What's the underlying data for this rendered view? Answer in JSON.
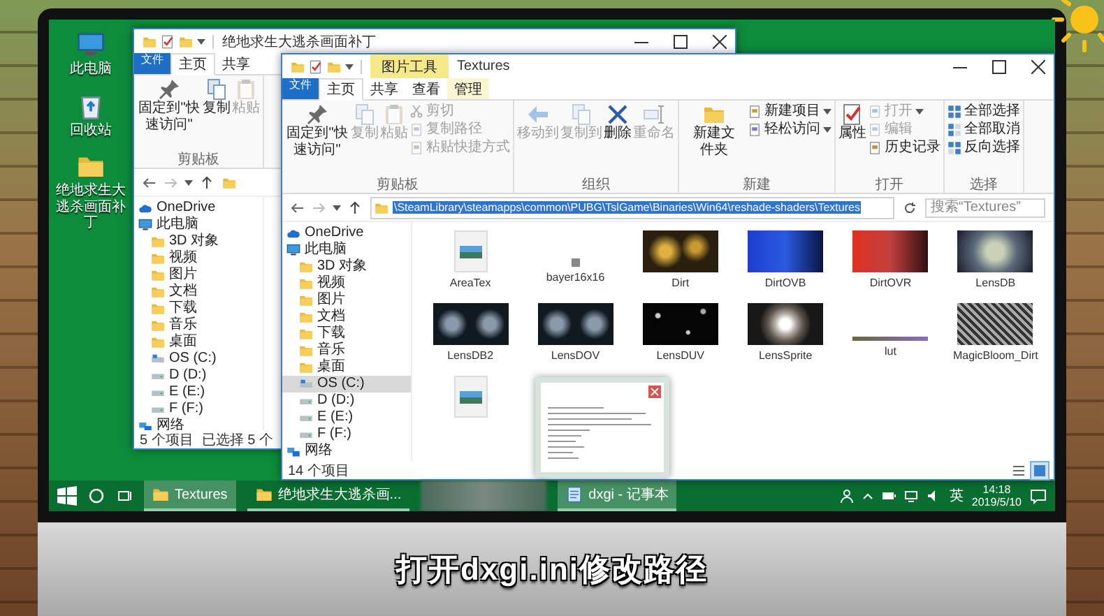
{
  "desktop_icons": [
    {
      "label": "此电脑",
      "kind": "computer"
    },
    {
      "label": "回收站",
      "kind": "recycle"
    },
    {
      "label": "绝地求生大逃杀画面补丁",
      "kind": "folder"
    }
  ],
  "back_window": {
    "title": "绝地求生大逃杀画面补丁",
    "tabs": [
      {
        "label": "文件",
        "kind": "file",
        "selected": false
      },
      {
        "label": "主页",
        "kind": "tab",
        "selected": true
      },
      {
        "label": "共享",
        "kind": "tab",
        "selected": false
      }
    ],
    "ribbon": [
      {
        "label": "剪贴板",
        "columns": [
          {
            "kind": "pin",
            "label": "固定到\"快速访问\"",
            "disabled": false,
            "dropdown": false
          },
          {
            "kind": "copy",
            "label": "复制",
            "disabled": false,
            "dropdown": false
          },
          {
            "kind": "paste",
            "label": "粘贴",
            "disabled": true,
            "dropdown": false
          }
        ]
      }
    ],
    "nav": [
      {
        "label": "OneDrive",
        "kind": "cloud",
        "selected": false
      },
      {
        "label": "此电脑",
        "kind": "computer",
        "selected": false,
        "children": [
          {
            "label": "3D 对象",
            "kind": "folder",
            "selected": false
          },
          {
            "label": "视频",
            "kind": "folder",
            "selected": false
          },
          {
            "label": "图片",
            "kind": "folder",
            "selected": false
          },
          {
            "label": "文档",
            "kind": "folder",
            "selected": false
          },
          {
            "label": "下载",
            "kind": "folder",
            "selected": false
          },
          {
            "label": "音乐",
            "kind": "folder",
            "selected": false
          },
          {
            "label": "桌面",
            "kind": "folder",
            "selected": false
          },
          {
            "label": "OS (C:)",
            "kind": "system-drive",
            "selected": false
          },
          {
            "label": "D (D:)",
            "kind": "drive",
            "selected": false
          },
          {
            "label": "E (E:)",
            "kind": "drive",
            "selected": false
          },
          {
            "label": "F (F:)",
            "kind": "drive",
            "selected": false
          }
        ]
      },
      {
        "label": "网络",
        "kind": "network",
        "selected": false
      }
    ],
    "status": [
      "5 个项目",
      "已选择 5 个"
    ]
  },
  "front_window": {
    "context_label": "图片工具",
    "title": "Textures",
    "tabs": [
      {
        "label": "文件",
        "kind": "file",
        "selected": false
      },
      {
        "label": "主页",
        "kind": "tab",
        "selected": true
      },
      {
        "label": "共享",
        "kind": "tab",
        "selected": false
      },
      {
        "label": "查看",
        "kind": "tab",
        "selected": false
      },
      {
        "label": "管理",
        "kind": "context",
        "selected": false
      }
    ],
    "ribbon": [
      {
        "label": "剪贴板",
        "columns": [
          {
            "kind": "pin",
            "label": "固定到\"快速访问\"",
            "disabled": false,
            "dropdown": false
          },
          {
            "kind": "copy",
            "label": "复制",
            "disabled": true,
            "dropdown": false
          },
          {
            "kind": "paste",
            "label": "粘贴",
            "disabled": true,
            "dropdown": false
          },
          {
            "kind": "stack",
            "items": [
              {
                "kind": "cut",
                "label": "剪切",
                "disabled": true,
                "dropdown": false
              },
              {
                "kind": "copypath",
                "label": "复制路径",
                "disabled": true,
                "dropdown": false
              },
              {
                "kind": "shortcut",
                "label": "粘贴快捷方式",
                "disabled": true,
                "dropdown": false
              }
            ]
          }
        ]
      },
      {
        "label": "组织",
        "columns": [
          {
            "kind": "move",
            "label": "移动到",
            "disabled": true,
            "dropdown": false
          },
          {
            "kind": "copy",
            "label": "复制到",
            "disabled": true,
            "dropdown": false
          },
          {
            "kind": "delete",
            "label": "删除",
            "disabled": false,
            "dropdown": false
          },
          {
            "kind": "rename",
            "label": "重命名",
            "disabled": true,
            "dropdown": false
          }
        ]
      },
      {
        "label": "新建",
        "columns": [
          {
            "kind": "newfolder",
            "label": "新建文件夹",
            "disabled": false,
            "dropdown": false
          },
          {
            "kind": "stack",
            "items": [
              {
                "kind": "newitem",
                "label": "新建项目",
                "disabled": false,
                "dropdown": true
              },
              {
                "kind": "easyaccess",
                "label": "轻松访问",
                "disabled": false,
                "dropdown": true
              }
            ]
          }
        ]
      },
      {
        "label": "打开",
        "columns": [
          {
            "kind": "properties",
            "label": "属性",
            "disabled": false,
            "dropdown": false
          },
          {
            "kind": "stack",
            "items": [
              {
                "kind": "open",
                "label": "打开",
                "disabled": true,
                "dropdown": true
              },
              {
                "kind": "edit",
                "label": "编辑",
                "disabled": true,
                "dropdown": false
              },
              {
                "kind": "history",
                "label": "历史记录",
                "disabled": false,
                "dropdown": false
              }
            ]
          }
        ]
      },
      {
        "label": "选择",
        "columns": [
          {
            "kind": "stack",
            "items": [
              {
                "kind": "selectall",
                "label": "全部选择",
                "disabled": false,
                "dropdown": false
              },
              {
                "kind": "selectnone",
                "label": "全部取消",
                "disabled": false,
                "dropdown": false
              },
              {
                "kind": "invert",
                "label": "反向选择",
                "disabled": false,
                "dropdown": false
              }
            ]
          }
        ]
      }
    ],
    "address": {
      "path": "\\SteamLibrary\\steamapps\\common\\PUBG\\TslGame\\Binaries\\Win64\\reshade-shaders\\Textures",
      "selected": true
    },
    "search": {
      "placeholder": "搜索“Textures”"
    },
    "nav": [
      {
        "label": "OneDrive",
        "kind": "cloud",
        "selected": false
      },
      {
        "label": "此电脑",
        "kind": "computer",
        "selected": false,
        "children": [
          {
            "label": "3D 对象",
            "kind": "folder",
            "selected": false
          },
          {
            "label": "视频",
            "kind": "folder",
            "selected": false
          },
          {
            "label": "图片",
            "kind": "folder",
            "selected": false
          },
          {
            "label": "文档",
            "kind": "folder",
            "selected": false
          },
          {
            "label": "下载",
            "kind": "folder",
            "selected": false
          },
          {
            "label": "音乐",
            "kind": "folder",
            "selected": false
          },
          {
            "label": "桌面",
            "kind": "folder",
            "selected": false
          },
          {
            "label": "OS (C:)",
            "kind": "system-drive",
            "selected": true
          },
          {
            "label": "D (D:)",
            "kind": "drive",
            "selected": false
          },
          {
            "label": "E (E:)",
            "kind": "drive",
            "selected": false
          },
          {
            "label": "F (F:)",
            "kind": "drive",
            "selected": false
          }
        ]
      },
      {
        "label": "网络",
        "kind": "network",
        "selected": false
      }
    ],
    "files": [
      {
        "name": "AreaTex",
        "kind": "file"
      },
      {
        "name": "bayer16x16",
        "kind": "tiny"
      },
      {
        "name": "Dirt",
        "kind": "bokeh"
      },
      {
        "name": "DirtOVB",
        "kind": "blue"
      },
      {
        "name": "DirtOVR",
        "kind": "red"
      },
      {
        "name": "LensDB",
        "kind": "kaleido"
      },
      {
        "name": "LensDB2",
        "kind": "pattern"
      },
      {
        "name": "LensDOV",
        "kind": "pattern"
      },
      {
        "name": "LensDUV",
        "kind": "stars"
      },
      {
        "name": "LensSprite",
        "kind": "ring"
      },
      {
        "name": "lut",
        "kind": "strip"
      },
      {
        "name": "MagicBloom_Dirt",
        "kind": "noise"
      },
      {
        "kind": "file"
      }
    ],
    "status": "14 个项目",
    "views": [
      {
        "kind": "details",
        "selected": false
      },
      {
        "kind": "icons",
        "selected": true
      }
    ]
  },
  "taskbar": {
    "buttons": [
      {
        "label": "Textures",
        "kind": "folder",
        "selected": true
      },
      {
        "label": "绝地求生大逃杀画...",
        "kind": "folder",
        "selected": false
      },
      {
        "kind": "blurred",
        "selected": false
      },
      {
        "label": "dxgi - 记事本",
        "kind": "notepad",
        "selected": true
      }
    ],
    "ime": "英",
    "time": "14:18",
    "date": "2019/5/10"
  },
  "subtitle": "打开dxgi.ini修改路径"
}
